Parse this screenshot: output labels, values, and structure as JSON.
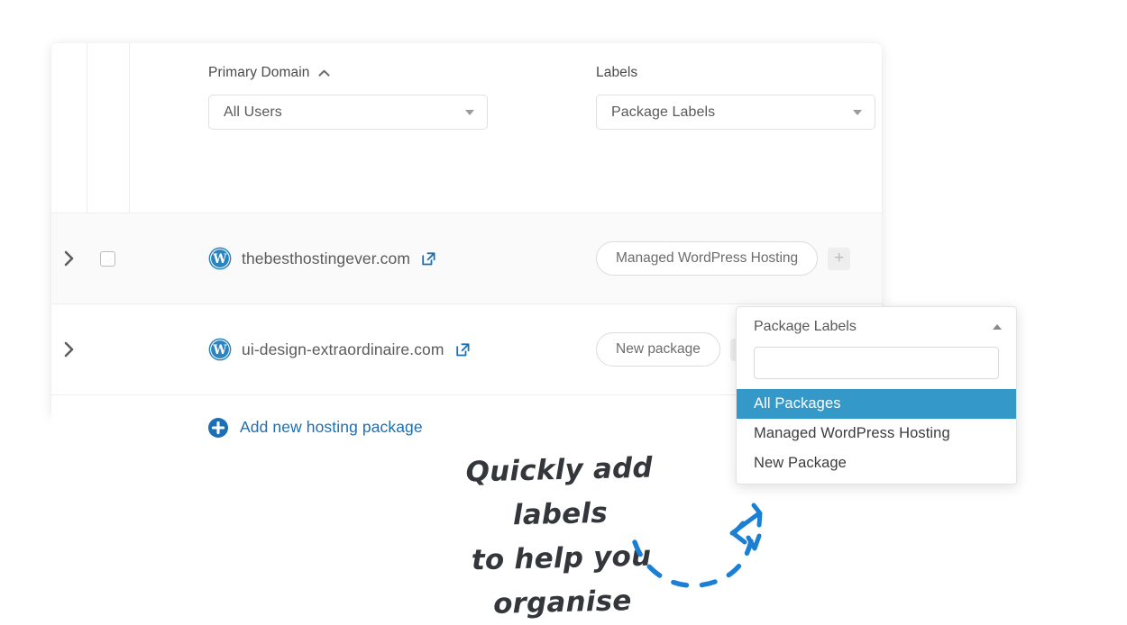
{
  "table": {
    "filters": {
      "primary_domain": {
        "header": "Primary Domain",
        "sort_icon": "caret-up-icon",
        "select_value": "All Users"
      },
      "labels": {
        "header": "Labels",
        "select_value": "Package Labels"
      }
    },
    "rows": [
      {
        "expand_icon": "chevron-right-icon",
        "has_checkbox": true,
        "site_icon": "wordpress-icon",
        "domain": "thebesthostingever.com",
        "external_link_icon": "external-link-icon",
        "label_chip": "Managed WordPress Hosting",
        "add_label_button": "+"
      },
      {
        "expand_icon": "chevron-right-icon",
        "has_checkbox": false,
        "site_icon": "wordpress-icon",
        "domain": "ui-design-extraordinaire.com",
        "external_link_icon": "external-link-icon",
        "label_chip": "New package",
        "add_label_button": "+"
      }
    ],
    "add_row": {
      "icon": "plus-circle-icon",
      "label": "Add new hosting package"
    }
  },
  "dropdown": {
    "title": "Package Labels",
    "toggle_icon": "caret-up-icon",
    "search_value": "",
    "search_placeholder": "",
    "options": [
      {
        "label": "All Packages",
        "selected": true
      },
      {
        "label": "Managed WordPress Hosting",
        "selected": false
      },
      {
        "label": "New Package",
        "selected": false
      }
    ]
  },
  "annotation": {
    "line1": "Quickly add labels",
    "line2": "to help you organise",
    "arrow_icon": "curved-dashed-arrow-icon"
  },
  "colors": {
    "accent_blue": "#1b6fb5",
    "highlight_blue": "#3498c8",
    "arrow_blue": "#1b7fd4",
    "row_alt_bg": "#fafafa",
    "text_dark": "#58595b"
  }
}
